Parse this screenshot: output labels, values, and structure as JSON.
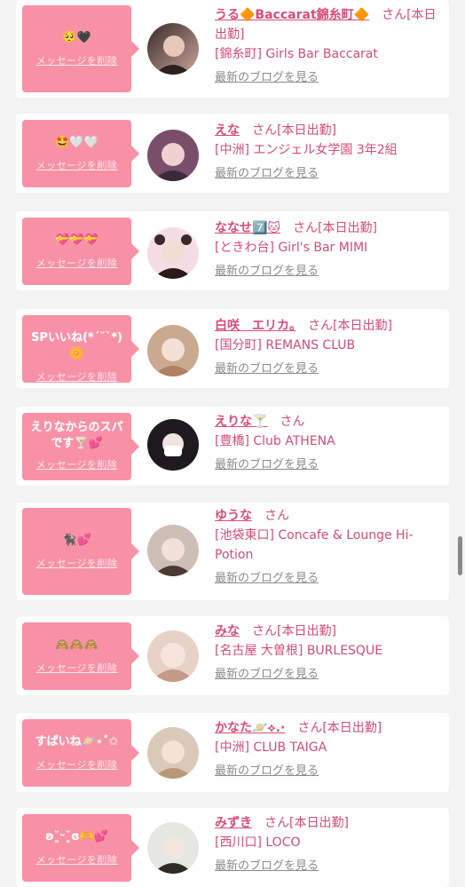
{
  "delete_label": "メッセージを削除",
  "blog_label": "最新のブログを見る",
  "accent_color": "#f891a6",
  "items": [
    {
      "message": "🥺🖤",
      "name": "うる🔶Baccarat錦糸町🔶",
      "san": "さん",
      "tag": "[本日出勤]",
      "shop": "[錦糸町] Girls Bar Baccarat",
      "avatar": "avatar-photo"
    },
    {
      "message": "🤩🤍🤍",
      "name": "えな",
      "san": "さん",
      "tag": "[本日出勤]",
      "shop": "[中洲] エンジェル女学園 3年2組",
      "avatar": "avatar-photo"
    },
    {
      "message": "💝💝💝",
      "name": "ななせ7️⃣🐱",
      "san": "さん",
      "tag": "[本日出勤]",
      "shop": "[ときわ台] Girl's Bar MIMI",
      "avatar": "avatar-photo"
    },
    {
      "message": "SPいいね(*´˘`*)🌼",
      "name": "白咲　エリカ。",
      "san": "さん",
      "tag": "[本日出勤]",
      "shop": "[国分町] REMANS CLUB",
      "avatar": "avatar-photo"
    },
    {
      "message": "えりなからのスパです🍸💕",
      "name": "えりな🍸",
      "san": "さん",
      "tag": "",
      "shop": "[豊橋] Club ATHENA",
      "avatar": "avatar-photo"
    },
    {
      "message": "🐈‍⬛💕",
      "name": "ゆうな",
      "san": "さん",
      "tag": "",
      "shop": "[池袋東口] Concafe & Lounge Hi-Potion",
      "avatar": "avatar-photo"
    },
    {
      "message": "🙈🙈🙈",
      "name": "みな",
      "san": "さん",
      "tag": "[本日出勤]",
      "shop": "[名古屋 大曽根] BURLESQUE",
      "avatar": "avatar-photo"
    },
    {
      "message": "すぱいね🪐⋆˚✩",
      "name": "かなた🪐⟡.·",
      "san": "さん",
      "tag": "[本日出勤]",
      "shop": "[中洲] CLUB TAIGA",
      "avatar": "avatar-photo"
    },
    {
      "message": "ʚ˘͈ᵕ˘͈ɞ🫶💕",
      "name": "みずき",
      "san": "さん",
      "tag": "[本日出勤]",
      "shop": "[西川口] LOCO",
      "avatar": "avatar-photo"
    }
  ]
}
